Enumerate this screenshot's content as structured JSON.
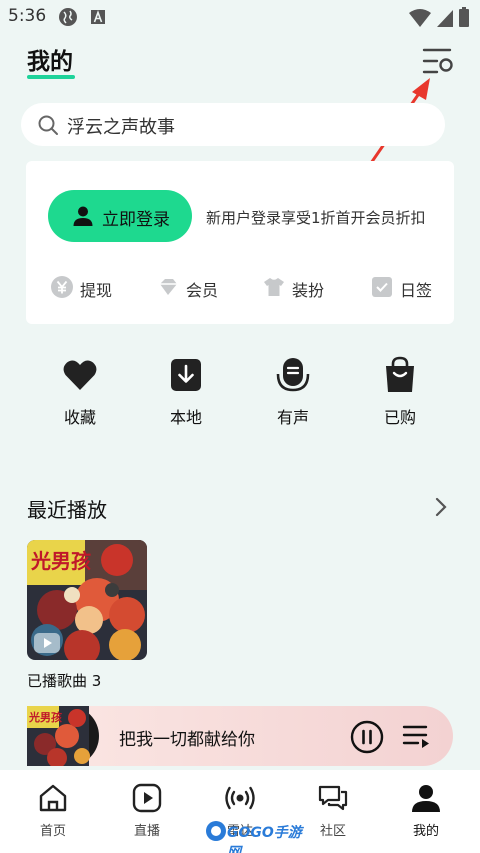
{
  "status_bar": {
    "time": "5:36",
    "icons": [
      "globe-icon",
      "a-icon",
      "wifi-icon",
      "signal-icon",
      "battery-icon"
    ]
  },
  "header": {
    "title": "我的",
    "settings_icon": "settings-list-icon",
    "accent_color": "#1ed39a"
  },
  "annotation": {
    "icon": "red-arrow",
    "color": "#e8372c"
  },
  "search": {
    "placeholder": "浮云之声故事",
    "icon": "search-icon"
  },
  "account_card": {
    "login_label": "立即登录",
    "login_color": "#1ed98f",
    "promo_text": "新用户登录享受1折首开会员折扣",
    "items": [
      {
        "label": "提现",
        "icon": "yen-icon"
      },
      {
        "label": "会员",
        "icon": "diamond-icon"
      },
      {
        "label": "装扮",
        "icon": "tshirt-icon"
      },
      {
        "label": "日签",
        "icon": "checkbox-icon"
      }
    ]
  },
  "quick_actions": [
    {
      "label": "收藏",
      "icon": "heart-icon"
    },
    {
      "label": "本地",
      "icon": "download-icon"
    },
    {
      "label": "有声",
      "icon": "microphone-icon"
    },
    {
      "label": "已购",
      "icon": "shopping-bag-icon"
    }
  ],
  "recent": {
    "title": "最近播放",
    "item_label": "已播歌曲 3",
    "cover_text": "光男孩"
  },
  "player": {
    "song_title": "把我一切都献给你"
  },
  "bottom_nav": [
    {
      "label": "首页",
      "icon": "home-icon"
    },
    {
      "label": "直播",
      "icon": "play-icon"
    },
    {
      "label": "雷达",
      "icon": "radio-icon"
    },
    {
      "label": "社区",
      "icon": "chat-icon"
    },
    {
      "label": "我的",
      "icon": "person-icon"
    }
  ],
  "watermark": {
    "text": "GOGO手游网"
  }
}
